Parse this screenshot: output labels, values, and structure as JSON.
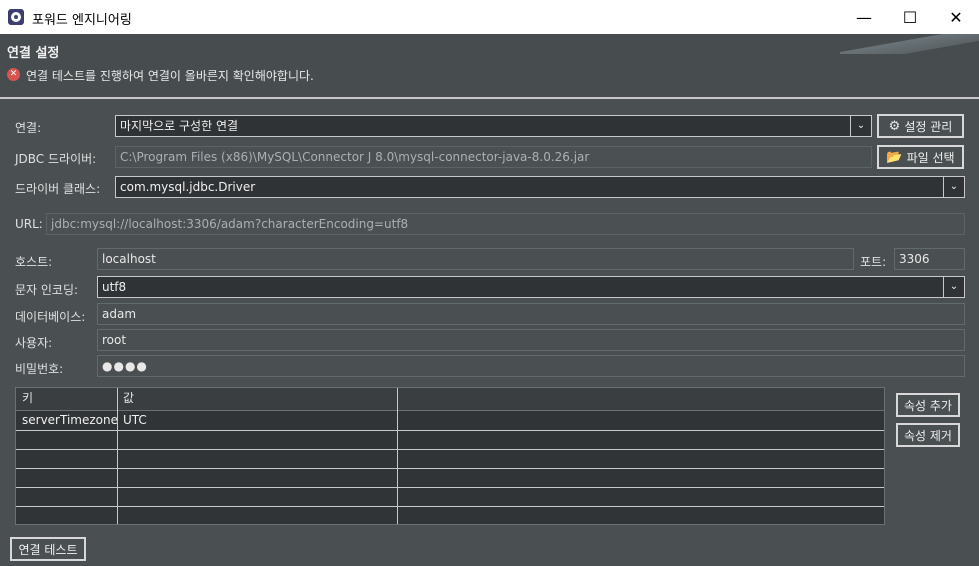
{
  "window": {
    "title": "포워드 엔지니어링",
    "controls": {
      "minimize": "—",
      "maximize": "☐",
      "close": "✕"
    }
  },
  "header": {
    "title": "연결 설정",
    "error_message": "연결 테스트를 진행하여 연결이 올바른지 확인해야합니다."
  },
  "connection": {
    "label": "연결:",
    "value": "마지막으로 구성한 연결",
    "manage_button": "설정 관리"
  },
  "jdbc_driver": {
    "label": "JDBC 드라이버:",
    "value": "C:\\Program Files (x86)\\MySQL\\Connector J 8.0\\mysql-connector-java-8.0.26.jar",
    "select_file_button": "파일 선택"
  },
  "driver_class": {
    "label": "드라이버 클래스:",
    "value": "com.mysql.jdbc.Driver"
  },
  "url": {
    "label": "URL:",
    "value": "jdbc:mysql://localhost:3306/adam?characterEncoding=utf8"
  },
  "host": {
    "label": "호스트:",
    "value": "localhost"
  },
  "port": {
    "label": "포트:",
    "value": "3306"
  },
  "encoding": {
    "label": "문자 인코딩:",
    "value": "utf8"
  },
  "database": {
    "label": "데이터베이스:",
    "value": "adam"
  },
  "user": {
    "label": "사용자:",
    "value": "root"
  },
  "password": {
    "label": "비밀번호:",
    "value": "●●●●"
  },
  "properties": {
    "columns": [
      "키",
      "값"
    ],
    "rows": [
      {
        "key": "serverTimezone",
        "value": "UTC"
      },
      {
        "key": "",
        "value": ""
      },
      {
        "key": "",
        "value": ""
      },
      {
        "key": "",
        "value": ""
      },
      {
        "key": "",
        "value": ""
      },
      {
        "key": "",
        "value": ""
      }
    ],
    "add_button": "속성 추가",
    "remove_button": "속성 제거"
  },
  "test_button": "연결 테스트",
  "icons": {
    "gear": "⚙",
    "folder": "📂",
    "error": "✕",
    "dropdown": "⌄"
  }
}
